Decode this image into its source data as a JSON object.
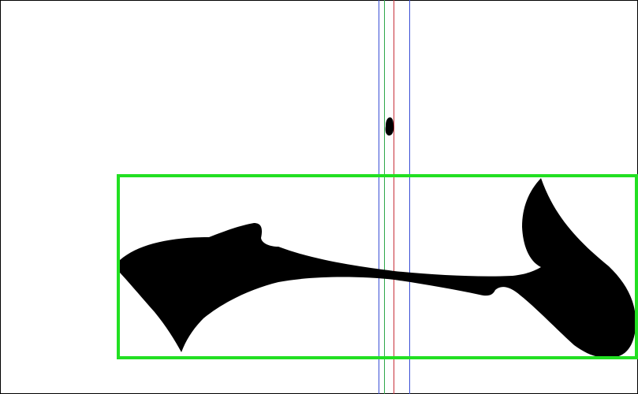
{
  "canvas": {
    "background_color": "#ffffff",
    "frame_color": "#000000"
  },
  "glyph": {
    "fill_color": "#000000"
  },
  "bounding_box": {
    "stroke_color": "#22e022"
  },
  "guides": {
    "colors": [
      "#3a4fd6",
      "#2fa84a",
      "#c8303a",
      "#3a4fd6"
    ]
  }
}
